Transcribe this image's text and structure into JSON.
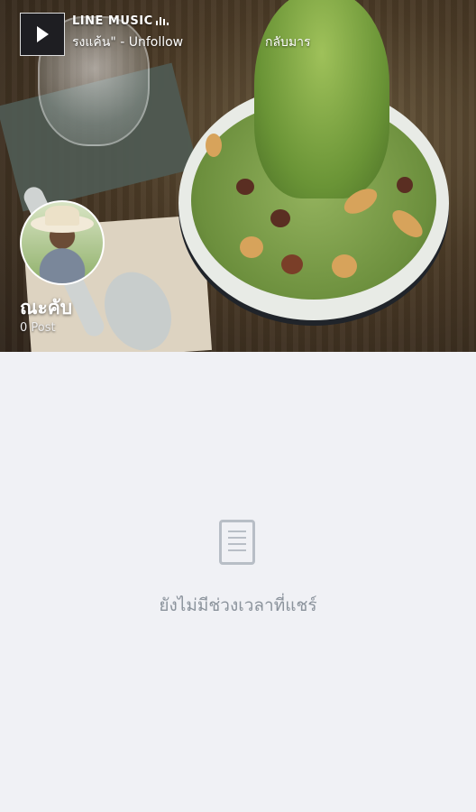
{
  "music": {
    "label": "LINE MUSIC",
    "song": "รงแค้น\" - Unfollow",
    "back_label": "กลับมาร"
  },
  "profile": {
    "name": "ณะคับ",
    "post_count": "0 Post"
  },
  "timeline": {
    "empty_message": "ยังไม่มีช่วงเวลาที่แชร์"
  },
  "icons": {
    "play": "play-icon",
    "equalizer": "equalizer-icon",
    "document": "document-icon"
  }
}
